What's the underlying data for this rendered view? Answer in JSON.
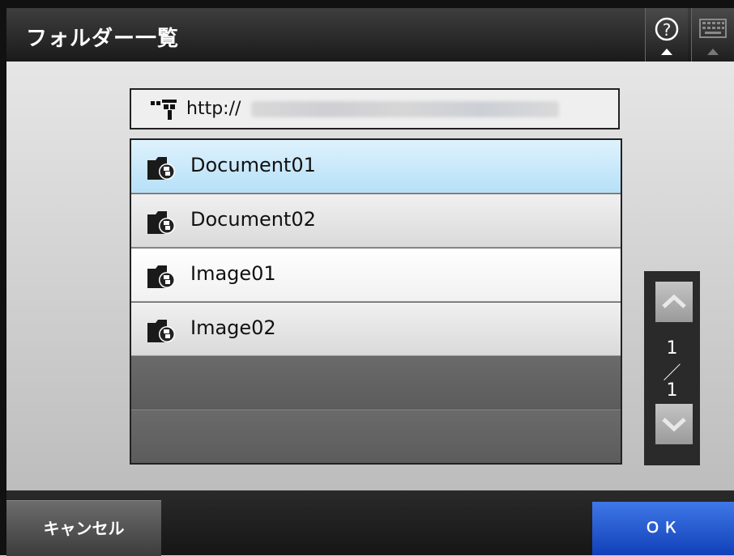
{
  "header": {
    "title": "フォルダー一覧",
    "help_icon": "question-circle-icon",
    "keyboard_icon": "keyboard-icon"
  },
  "path": {
    "icon": "network-icon",
    "text": "http://"
  },
  "folders": [
    {
      "icon": "network-folder-icon",
      "label": "Document01",
      "selected": true
    },
    {
      "icon": "network-folder-icon",
      "label": "Document02",
      "selected": false
    },
    {
      "icon": "network-folder-icon",
      "label": "Image01",
      "selected": false
    },
    {
      "icon": "network-folder-icon",
      "label": "Image02",
      "selected": false
    }
  ],
  "pager": {
    "current": "1",
    "separator": "／",
    "total": "1"
  },
  "footer": {
    "cancel_label": "キャンセル",
    "ok_label": "ＯＫ"
  },
  "colors": {
    "selected_row": "#c4e7fb",
    "ok_button": "#2a5fd6",
    "title_bar": "#2a2a2a"
  }
}
